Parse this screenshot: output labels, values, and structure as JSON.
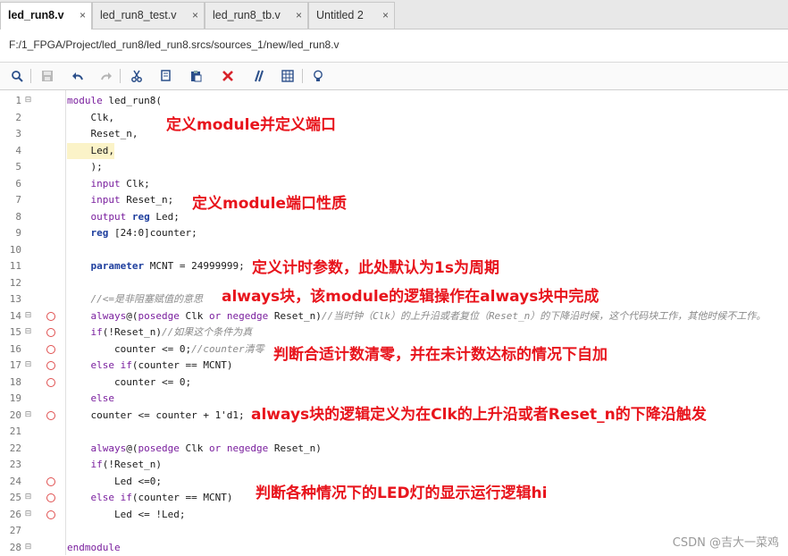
{
  "tabs": [
    {
      "label": "led_run8.v",
      "active": true
    },
    {
      "label": "led_run8_test.v",
      "active": false
    },
    {
      "label": "led_run8_tb.v",
      "active": false
    },
    {
      "label": "Untitled 2",
      "active": false
    }
  ],
  "tab_close_glyph": "×",
  "file_path": "F:/1_FPGA/Project/led_run8/led_run8.srcs/sources_1/new/led_run8.v",
  "toolbar_icons": [
    "search-icon",
    "save-icon",
    "undo-icon",
    "redo-icon",
    "cut-icon",
    "copy-icon",
    "paste-icon",
    "delete-icon",
    "comment-toggle-icon",
    "column-select-icon",
    "lightbulb-icon"
  ],
  "code_lines": [
    {
      "n": "1",
      "text": "module led_run8(",
      "fold": true,
      "bp": false
    },
    {
      "n": "2",
      "text": "    Clk,",
      "fold": false,
      "bp": false
    },
    {
      "n": "3",
      "text": "    Reset_n,",
      "fold": false,
      "bp": false
    },
    {
      "n": "4",
      "text": "    Led,",
      "fold": false,
      "bp": false,
      "highlight": true
    },
    {
      "n": "5",
      "text": "    );",
      "fold": false,
      "bp": false
    },
    {
      "n": "6",
      "text": "    input Clk;",
      "fold": false,
      "bp": false
    },
    {
      "n": "7",
      "text": "    input Reset_n;",
      "fold": false,
      "bp": false
    },
    {
      "n": "8",
      "text": "    output reg Led;",
      "fold": false,
      "bp": false
    },
    {
      "n": "9",
      "text": "    reg [24:0]counter;",
      "fold": false,
      "bp": false
    },
    {
      "n": "10",
      "text": "",
      "fold": false,
      "bp": false
    },
    {
      "n": "11",
      "text": "    parameter MCNT = 24999999;",
      "fold": false,
      "bp": false
    },
    {
      "n": "12",
      "text": "",
      "fold": false,
      "bp": false
    },
    {
      "n": "13",
      "text": "    //<=是非阻塞赋值的意思",
      "fold": false,
      "bp": false
    },
    {
      "n": "14",
      "text": "    always@(posedge Clk or negedge Reset_n)//当时钟（Clk）的上升沿或者复位（Reset_n）的下降沿时候，这个代码块工作，其他时候不工作。",
      "fold": true,
      "bp": true
    },
    {
      "n": "15",
      "text": "    if(!Reset_n)//如果这个条件为真",
      "fold": true,
      "bp": true
    },
    {
      "n": "16",
      "text": "        counter <= 0;//counter清零",
      "fold": false,
      "bp": true
    },
    {
      "n": "17",
      "text": "    else if(counter == MCNT)",
      "fold": true,
      "bp": true
    },
    {
      "n": "18",
      "text": "        counter <= 0;",
      "fold": false,
      "bp": true
    },
    {
      "n": "19",
      "text": "    else",
      "fold": false,
      "bp": false
    },
    {
      "n": "20",
      "text": "    counter <= counter + 1'd1;",
      "fold": true,
      "bp": true
    },
    {
      "n": "21",
      "text": "",
      "fold": false,
      "bp": false
    },
    {
      "n": "22",
      "text": "    always@(posedge Clk or negedge Reset_n)",
      "fold": false,
      "bp": false
    },
    {
      "n": "23",
      "text": "    if(!Reset_n)",
      "fold": false,
      "bp": false
    },
    {
      "n": "24",
      "text": "        Led <=0;",
      "fold": false,
      "bp": true
    },
    {
      "n": "25",
      "text": "    else if(counter == MCNT)",
      "fold": true,
      "bp": true
    },
    {
      "n": "26",
      "text": "        Led <= !Led;",
      "fold": true,
      "bp": true
    },
    {
      "n": "27",
      "text": "",
      "fold": false,
      "bp": false
    },
    {
      "n": "28",
      "text": "endmodule",
      "fold": true,
      "bp": false
    }
  ],
  "annotations": [
    "定义module并定义端口",
    "定义module端口性质",
    "定义计时参数，此处默认为1s为周期",
    "always块，该module的逻辑操作在always块中完成",
    "判断合适计数清零，并在未计数达标的情况下自加",
    "always块的逻辑定义为在Clk的上升沿或者Reset_n的下降沿触发",
    "判断各种情况下的LED灯的显示运行逻辑hi"
  ],
  "watermark": "CSDN @吉大一菜鸡",
  "colors": {
    "annotation": "#e8141c",
    "keyword": "#1f3f9e",
    "comment": "#8a8a8a",
    "breakpoint": "#e05050"
  }
}
